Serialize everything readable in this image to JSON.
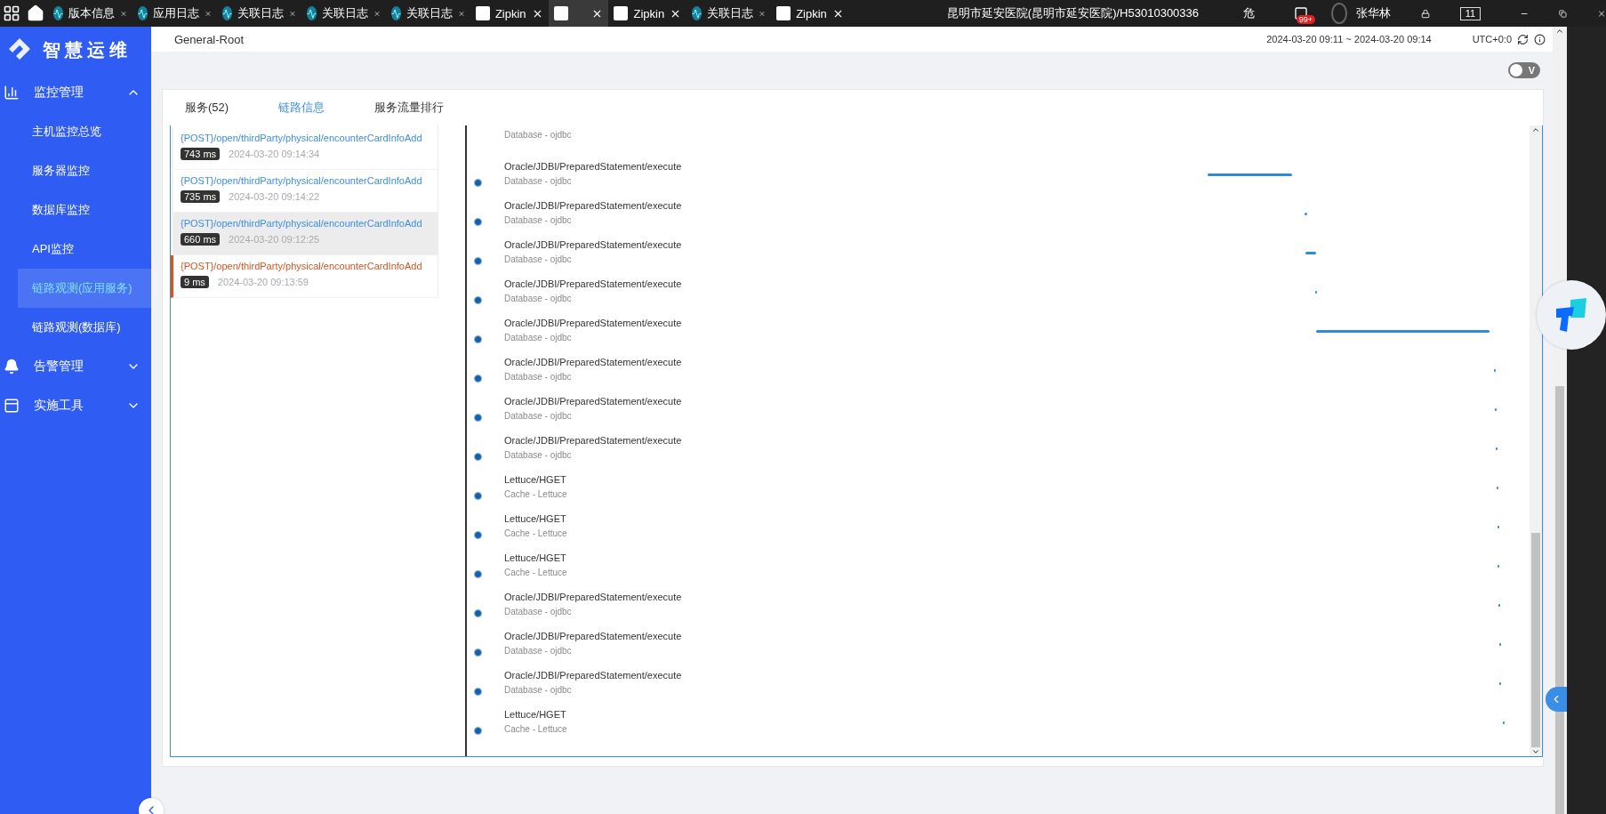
{
  "taskbar": {
    "tabs": [
      {
        "label": "版本信息",
        "kind": "app",
        "selected": false
      },
      {
        "label": "应用日志",
        "kind": "app",
        "selected": false
      },
      {
        "label": "关联日志",
        "kind": "app",
        "selected": false
      },
      {
        "label": "关联日志",
        "kind": "app",
        "selected": false
      },
      {
        "label": "关联日志",
        "kind": "app",
        "selected": false
      },
      {
        "label": "Zipkin",
        "kind": "page",
        "selected": false
      },
      {
        "kind": "page",
        "selected": true
      },
      {
        "label": "Zipkin",
        "kind": "page",
        "selected": false
      },
      {
        "label": "关联日志",
        "kind": "app",
        "selected": false
      },
      {
        "label": "Zipkin",
        "kind": "page",
        "selected": false
      }
    ],
    "title": "昆明市延安医院(昆明市延安医院)/H53010300336",
    "warning": "危",
    "notification_count": "99+",
    "user": "张华林",
    "screen_count": "11"
  },
  "sidebar": {
    "logo": "智慧运维",
    "groups": [
      {
        "label": "监控管理",
        "expanded": true,
        "children": [
          {
            "label": "主机监控总览",
            "selected": false
          },
          {
            "label": "服务器监控",
            "selected": false
          },
          {
            "label": "数据库监控",
            "selected": false
          },
          {
            "label": "API监控",
            "selected": false
          },
          {
            "label": "链路观测(应用服务)",
            "selected": true
          },
          {
            "label": "链路观测(数据库)",
            "selected": false
          }
        ]
      },
      {
        "label": "告警管理",
        "expanded": false
      },
      {
        "label": "实施工具",
        "expanded": false
      }
    ]
  },
  "header": {
    "title": "General-Root",
    "time_range": "2024-03-20 09:11 ~ 2024-03-20 09:14",
    "timezone": "UTC+0:0"
  },
  "toggle": {
    "label": "V",
    "on": false
  },
  "tabs": [
    {
      "label": "服务(52)",
      "selected": false
    },
    {
      "label": "链路信息",
      "selected": true
    },
    {
      "label": "服务流量排行",
      "selected": false
    }
  ],
  "traces": [
    {
      "endpoint": "{POST}/open/thirdParty/physical/encounterCardInfoAdd",
      "duration": "743 ms",
      "time": "2024-03-20 09:14:34",
      "selected": false,
      "error": false
    },
    {
      "endpoint": "{POST}/open/thirdParty/physical/encounterCardInfoAdd",
      "duration": "735 ms",
      "time": "2024-03-20 09:14:22",
      "selected": false,
      "error": false
    },
    {
      "endpoint": "{POST}/open/thirdParty/physical/encounterCardInfoAdd",
      "duration": "660 ms",
      "time": "2024-03-20 09:12:25",
      "selected": true,
      "error": false
    },
    {
      "endpoint": "{POST}/open/thirdParty/physical/encounterCardInfoAdd",
      "duration": "9 ms",
      "time": "2024-03-20 09:13:59",
      "selected": false,
      "error": true
    }
  ],
  "spans": [
    {
      "component": "Database - ojdbc"
    },
    {
      "name": "Oracle/JDBI/PreparedStatement/execute",
      "component": "Database - ojdbc"
    },
    {
      "name": "Oracle/JDBI/PreparedStatement/execute",
      "component": "Database - ojdbc"
    },
    {
      "name": "Oracle/JDBI/PreparedStatement/execute",
      "component": "Database - ojdbc"
    },
    {
      "name": "Oracle/JDBI/PreparedStatement/execute",
      "component": "Database - ojdbc"
    },
    {
      "name": "Oracle/JDBI/PreparedStatement/execute",
      "component": "Database - ojdbc"
    },
    {
      "name": "Oracle/JDBI/PreparedStatement/execute",
      "component": "Database - ojdbc"
    },
    {
      "name": "Oracle/JDBI/PreparedStatement/execute",
      "component": "Database - ojdbc"
    },
    {
      "name": "Oracle/JDBI/PreparedStatement/execute",
      "component": "Database - ojdbc"
    },
    {
      "name": "Lettuce/HGET",
      "component": "Cache - Lettuce"
    },
    {
      "name": "Lettuce/HGET",
      "component": "Cache - Lettuce"
    },
    {
      "name": "Lettuce/HGET",
      "component": "Cache - Lettuce"
    },
    {
      "name": "Oracle/JDBI/PreparedStatement/execute",
      "component": "Database - ojdbc"
    },
    {
      "name": "Oracle/JDBI/PreparedStatement/execute",
      "component": "Database - ojdbc"
    },
    {
      "name": "Oracle/JDBI/PreparedStatement/execute",
      "component": "Database - ojdbc"
    },
    {
      "name": "Lettuce/HGET",
      "component": "Cache - Lettuce"
    }
  ]
}
